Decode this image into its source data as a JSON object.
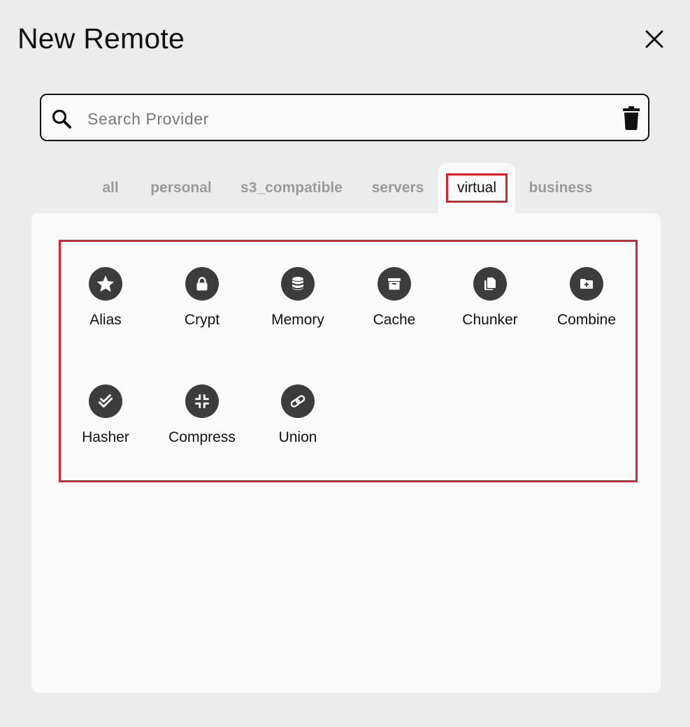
{
  "dialog": {
    "title": "New Remote",
    "close_icon": "close-icon"
  },
  "search": {
    "placeholder": "Search Provider",
    "value": "",
    "search_icon": "search-icon",
    "clear_icon": "trash-icon"
  },
  "tabs": [
    {
      "label": "all",
      "active": false
    },
    {
      "label": "personal",
      "active": false
    },
    {
      "label": "s3_compatible",
      "active": false
    },
    {
      "label": "servers",
      "active": false
    },
    {
      "label": "virtual",
      "active": true
    },
    {
      "label": "business",
      "active": false
    }
  ],
  "providers": [
    {
      "label": "Alias",
      "icon": "star-icon"
    },
    {
      "label": "Crypt",
      "icon": "lock-icon"
    },
    {
      "label": "Memory",
      "icon": "database-icon"
    },
    {
      "label": "Cache",
      "icon": "archive-icon"
    },
    {
      "label": "Chunker",
      "icon": "copy-icon"
    },
    {
      "label": "Combine",
      "icon": "folder-add-icon"
    },
    {
      "label": "Hasher",
      "icon": "check-all-icon"
    },
    {
      "label": "Compress",
      "icon": "compress-icon"
    },
    {
      "label": "Union",
      "icon": "link-icon"
    }
  ],
  "colors": {
    "highlight": "#d9222a",
    "icon_bg": "#3c3c3c",
    "panel_bg": "#fafafa",
    "page_bg": "#ececec"
  }
}
